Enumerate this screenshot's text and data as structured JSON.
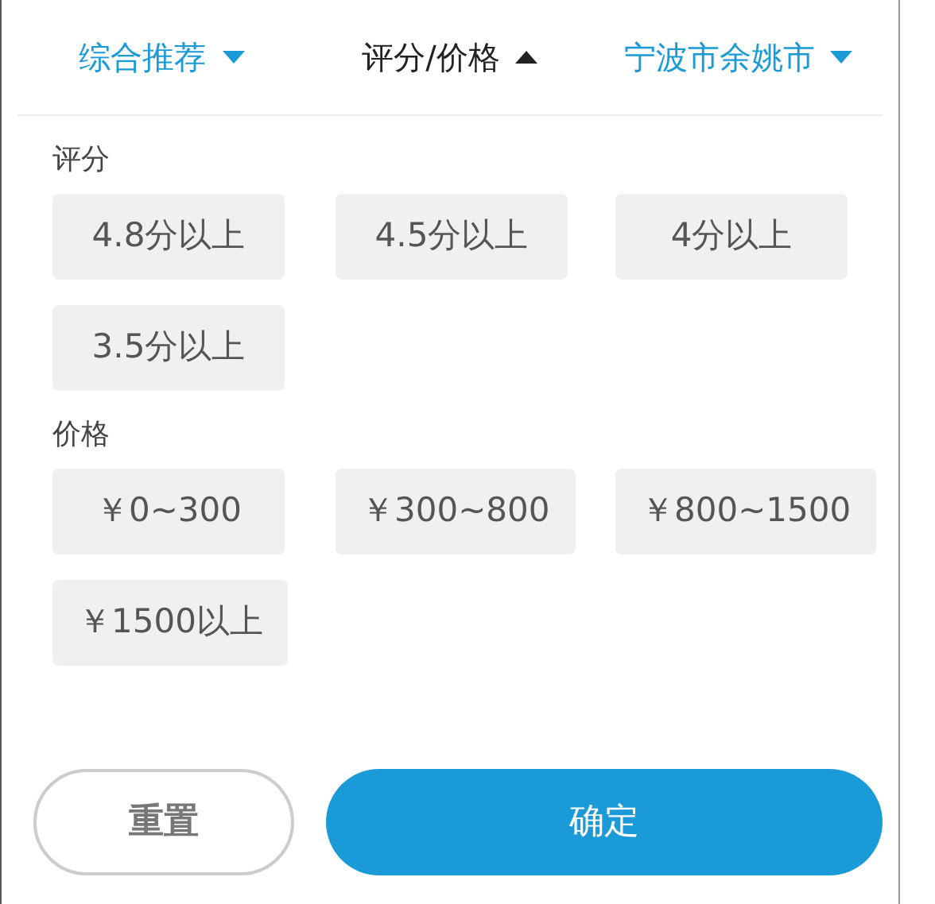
{
  "tabs": [
    {
      "label": "综合推荐",
      "selected": false
    },
    {
      "label": "评分/价格",
      "selected": true
    },
    {
      "label": "宁波市余姚市",
      "selected": false
    }
  ],
  "sections": [
    {
      "title": "评分",
      "options": [
        {
          "label": "4.8分以上",
          "selected": false
        },
        {
          "label": "4.5分以上",
          "selected": false
        },
        {
          "label": "4分以上",
          "selected": false
        },
        {
          "label": "3.5分以上",
          "selected": false
        }
      ]
    },
    {
      "title": "价格",
      "options": [
        {
          "label": "￥0~300",
          "selected": false
        },
        {
          "label": "￥300~800",
          "selected": false
        },
        {
          "label": "￥800~1500",
          "selected": false
        },
        {
          "label": "￥1500以上",
          "selected": false
        }
      ]
    }
  ],
  "buttons": [
    {
      "label": "重置",
      "kind": "secondary"
    },
    {
      "label": "确定",
      "kind": "primary"
    }
  ]
}
